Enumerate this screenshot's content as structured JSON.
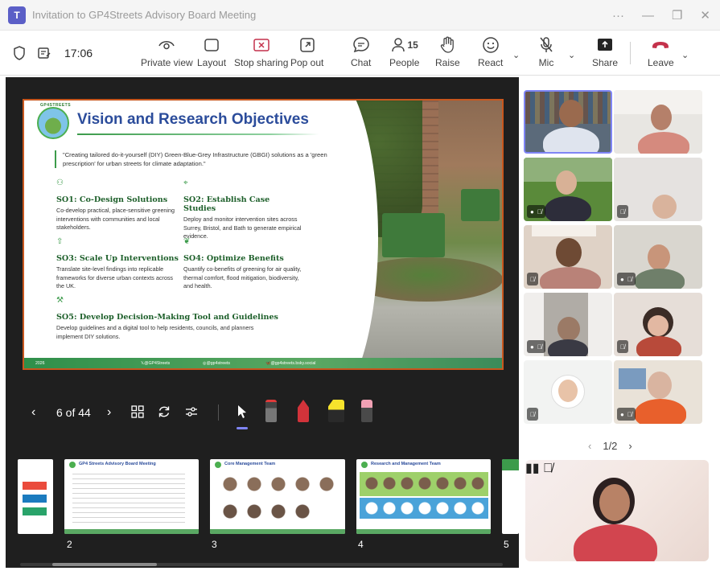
{
  "window": {
    "title": "Invitation to GP4Streets Advisory Board Meeting",
    "app_icon": "teams-icon"
  },
  "toolbar": {
    "time": "17:06",
    "private_view": "Private view",
    "layout": "Layout",
    "stop_sharing": "Stop sharing",
    "pop_out": "Pop out",
    "chat": "Chat",
    "people": "People",
    "people_count": "15",
    "raise": "Raise",
    "react": "React",
    "mic": "Mic",
    "share": "Share",
    "leave": "Leave"
  },
  "slide": {
    "title": "Vision and Research Objectives",
    "logo_text": "GP4STREETS",
    "quote": "\"Creating tailored do-it-yourself (DIY) Green-Blue-Grey Infrastructure (GBGI) solutions as a 'green prescription' for urban streets for climate adaptation.\"",
    "objectives": [
      {
        "title": "SO1: Co-Design Solutions",
        "desc": "Co-develop practical, place-sensitive greening interventions with communities and local stakeholders."
      },
      {
        "title": "SO2: Establish Case Studies",
        "desc": "Deploy and monitor intervention sites across Surrey, Bristol, and Bath to generate empirical evidence."
      },
      {
        "title": "SO3: Scale Up Interventions",
        "desc": "Translate site-level findings into replicable frameworks for diverse urban contexts across the UK."
      },
      {
        "title": "SO4: Optimize Benefits",
        "desc": "Quantify co-benefits of greening for air quality, thermal comfort, flood mitigation, biodiversity, and health."
      },
      {
        "title": "SO5: Develop Decision-Making Tool and Guidelines",
        "desc": "Develop guidelines and a digital tool to help residents, councils, and planners implement DIY solutions."
      }
    ],
    "footer": {
      "year": "2026",
      "x_handle": "@GP4Streets",
      "ig_handle": "@gp4streets",
      "bsky_handle": "@gp4streets.bsky.social"
    }
  },
  "presenter": {
    "counter": "6 of 44"
  },
  "thumbnails": [
    {
      "num": "2",
      "title": "GP4 Streets Advisory Board Meeting"
    },
    {
      "num": "3",
      "title": "Core Management Team"
    },
    {
      "num": "4",
      "title": "Research and Management Team"
    },
    {
      "num": "5",
      "title": ""
    }
  ],
  "panel": {
    "pager": "1/2"
  },
  "colors": {
    "accent": "#5b5fc7",
    "leave": "#c4314b",
    "stop_sharing": "#c4314b",
    "slide_border": "#c8571e",
    "slide_title": "#2b4c9b"
  }
}
